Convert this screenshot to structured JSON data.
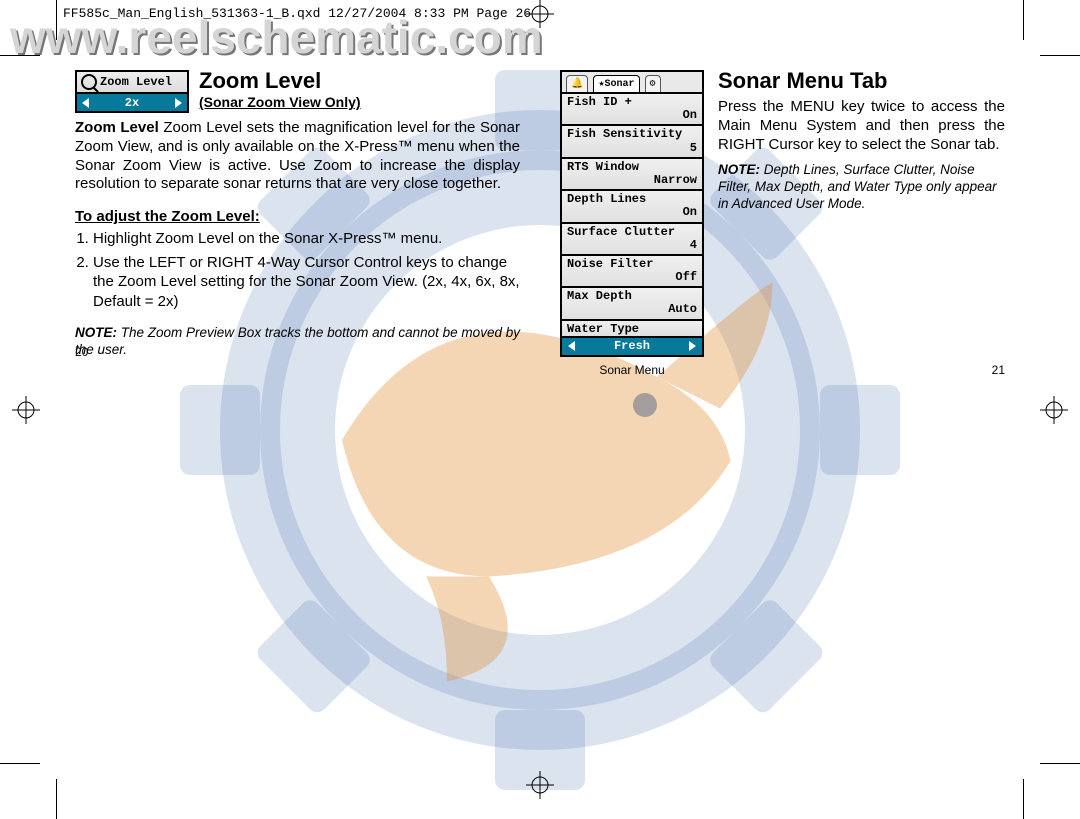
{
  "meta_header": "FF585c_Man_English_531363-1_B.qxd  12/27/2004  8:33 PM  Page 26",
  "watermark": "www.reelschematic.com",
  "left": {
    "page_num": "20",
    "screenshot": {
      "title": "Zoom Level",
      "value": "2x"
    },
    "title": "Zoom Level",
    "subtitle": "(Sonar Zoom View Only)",
    "body": "Zoom Level sets the magnification level for the Sonar Zoom View, and is only available on the X-Press™ menu when the Sonar Zoom View is active. Use Zoom to increase the display resolution to separate sonar returns that are very close together.",
    "section_h": "To adjust the Zoom Level:",
    "steps": [
      "Highlight Zoom Level on the Sonar X-Press™ menu.",
      "Use the LEFT or RIGHT 4-Way Cursor Control keys to change the Zoom Level setting for the Sonar Zoom View. (2x, 4x, 6x, 8x, Default = 2x)"
    ],
    "note_label": "NOTE:",
    "note": "The Zoom Preview Box tracks the bottom and cannot be moved by the user."
  },
  "right": {
    "page_num": "21",
    "title": "Sonar Menu Tab",
    "body": "Press the MENU key twice to access the Main Menu System and then press the RIGHT Cursor key to select the Sonar tab.",
    "note_label": "NOTE:",
    "note": "Depth Lines, Surface Clutter, Noise Filter, Max Depth, and Water Type only appear in Advanced User Mode.",
    "screenshot": {
      "tab": "Sonar",
      "items": [
        {
          "label": "Fish ID +",
          "value": "On"
        },
        {
          "label": "Fish Sensitivity",
          "value": "5"
        },
        {
          "label": "RTS Window",
          "value": "Narrow"
        },
        {
          "label": "Depth Lines",
          "value": "On"
        },
        {
          "label": "Surface Clutter",
          "value": "4"
        },
        {
          "label": "Noise Filter",
          "value": "Off"
        },
        {
          "label": "Max Depth",
          "value": "Auto"
        },
        {
          "label": "Water Type",
          "value": "Fresh"
        }
      ],
      "caption": "Sonar Menu"
    }
  }
}
